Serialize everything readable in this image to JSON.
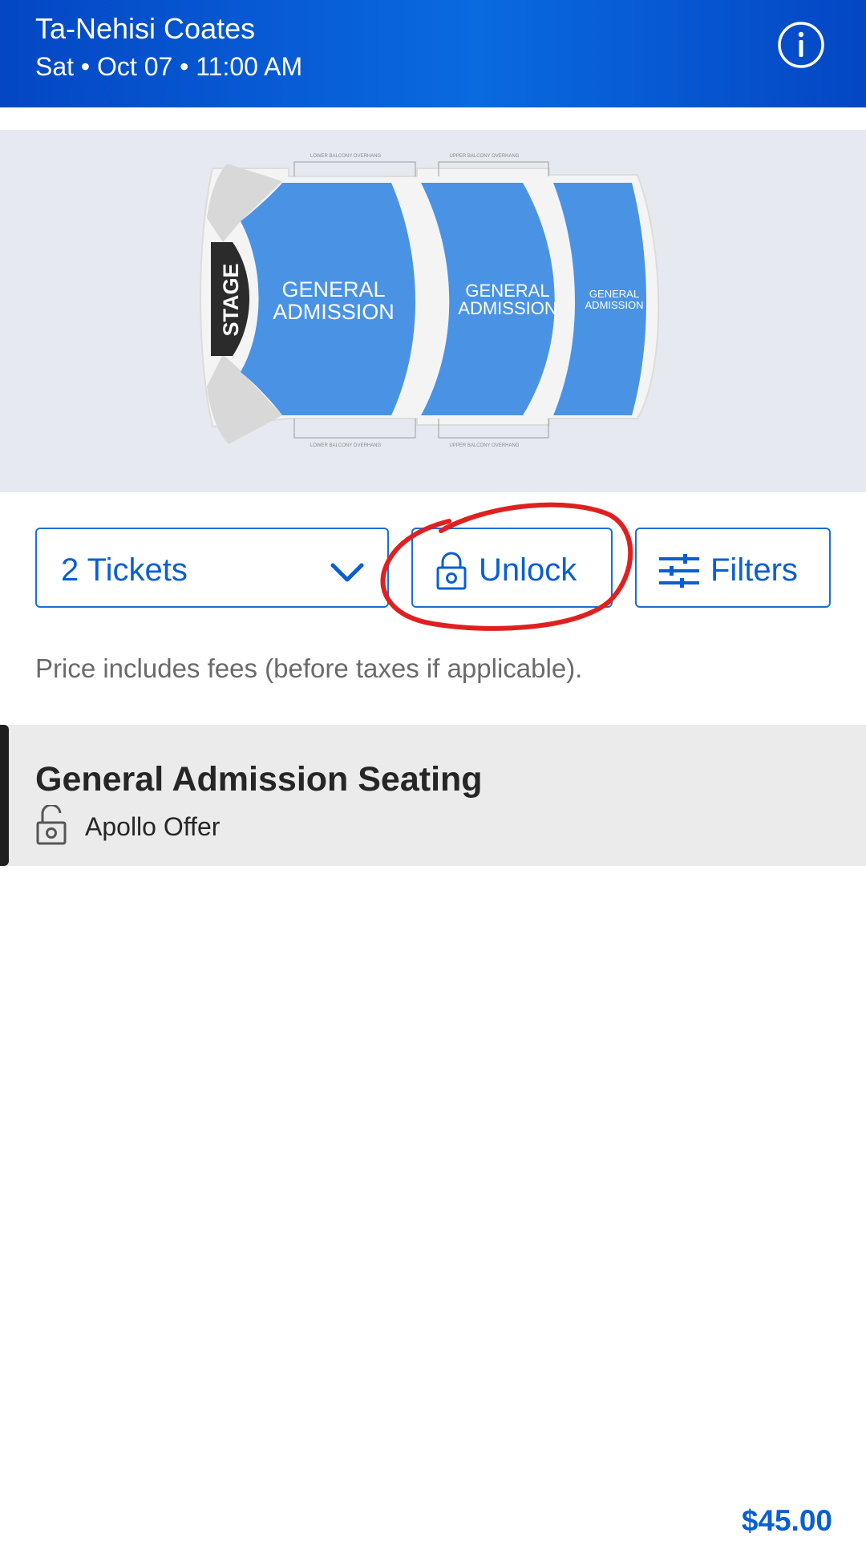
{
  "header": {
    "title": "Ta-Nehisi Coates",
    "subtitle": "Sat • Oct 07 • 11:00 AM",
    "info_icon": "info-icon"
  },
  "seat_map": {
    "stage_label": "STAGE",
    "section_label_1": "GENERAL ADMISSION",
    "section_label_2": "GENERAL ADMISSION",
    "section_label_3": "GENERAL ADMISSION",
    "lower_overhang_label": "LOWER BALCONY OVERHANG",
    "upper_overhang_label": "UPPER BALCONY OVERHANG",
    "colors": {
      "section": "#4a93e4",
      "stage": "#2b2b2b",
      "floor": "#f2f2f2",
      "wing": "#d6d6d6"
    }
  },
  "controls": {
    "tickets_label": "2 Tickets",
    "tickets_icon": "chevron-down-icon",
    "unlock_label": "Unlock",
    "unlock_icon": "lock-icon",
    "filters_label": "Filters",
    "filters_icon": "sliders-icon",
    "accent": "#1a6fd6"
  },
  "price_note": "Price includes fees (before taxes if applicable).",
  "listing": {
    "name": "General Admission Seating",
    "offer": "Apollo Offer",
    "offer_icon": "unlock-icon",
    "price": "$45.00"
  },
  "annotation": {
    "color": "#e02020",
    "target": "unlock-button"
  }
}
